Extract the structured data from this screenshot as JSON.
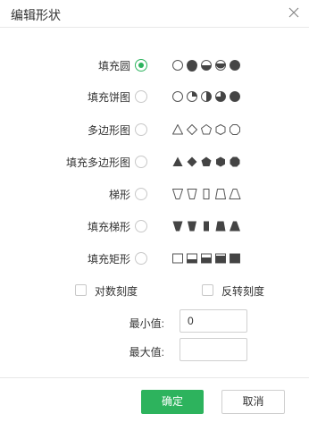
{
  "dialog": {
    "title": "编辑形状",
    "close_icon": "close-icon"
  },
  "shape_options": [
    {
      "label": "填充圆",
      "selected": true,
      "shapes_icon": "circle-fill-levels-icon"
    },
    {
      "label": "填充饼图",
      "selected": false,
      "shapes_icon": "pie-fill-levels-icon"
    },
    {
      "label": "多边形图",
      "selected": false,
      "shapes_icon": "polygon-outline-icon"
    },
    {
      "label": "填充多边形图",
      "selected": false,
      "shapes_icon": "polygon-filled-icon"
    },
    {
      "label": "梯形",
      "selected": false,
      "shapes_icon": "trapezoid-outline-icon"
    },
    {
      "label": "填充梯形",
      "selected": false,
      "shapes_icon": "trapezoid-filled-icon"
    },
    {
      "label": "填充矩形",
      "selected": false,
      "shapes_icon": "rect-fill-levels-icon"
    }
  ],
  "options": {
    "log_scale_label": "对数刻度",
    "log_scale_checked": false,
    "reverse_scale_label": "反转刻度",
    "reverse_scale_checked": false
  },
  "range": {
    "min_label": "最小值:",
    "min_value": "0",
    "max_label": "最大值:",
    "max_value": ""
  },
  "footer": {
    "ok_label": "确定",
    "cancel_label": "取消"
  },
  "colors": {
    "accent": "#2db35d",
    "shape_fill": "#444444",
    "shape_stroke": "#555555"
  }
}
